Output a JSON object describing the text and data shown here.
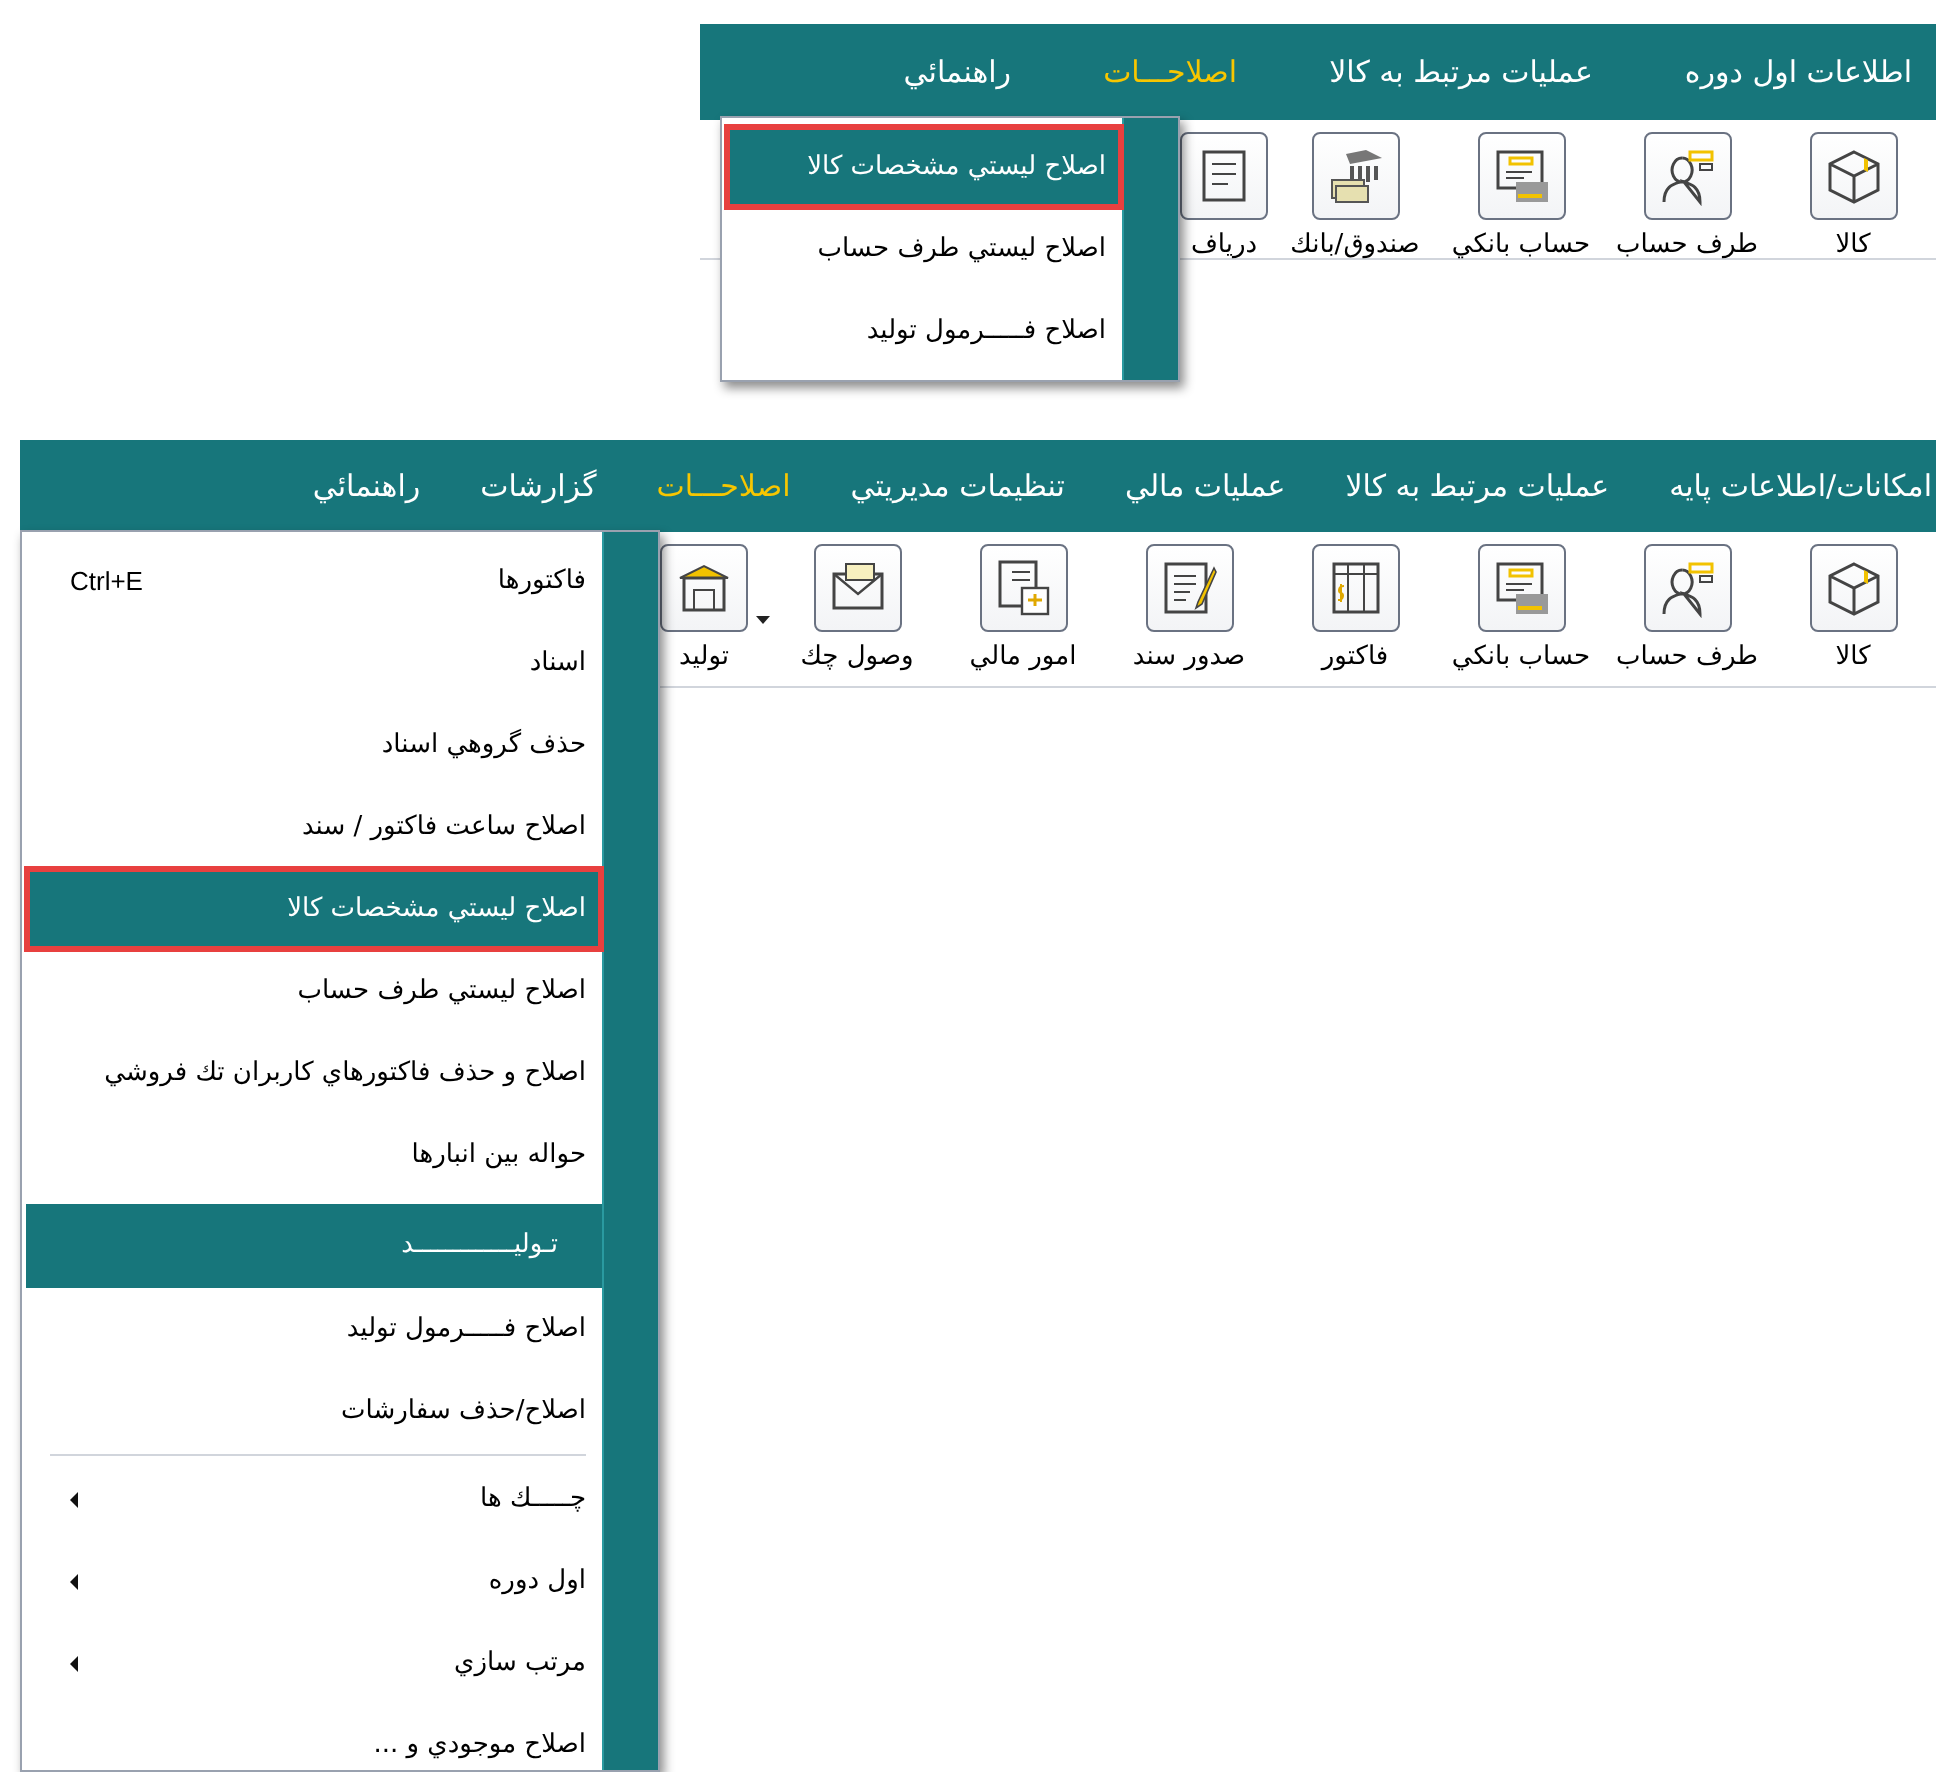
{
  "panels": [
    {
      "menubar": [
        {
          "label": "اطلاعات اول دوره",
          "selected": false
        },
        {
          "label": "عمليات مرتبط به كالا",
          "selected": false
        },
        {
          "label": "اصلاحـــات",
          "selected": true
        },
        {
          "label": "راهنمائي",
          "selected": false
        }
      ],
      "toolbar": [
        {
          "kind": "tool",
          "label": "كالا"
        },
        {
          "kind": "tool",
          "label": "طرف حساب"
        },
        {
          "kind": "tool",
          "label": "حساب بانكي"
        },
        {
          "kind": "tool",
          "label": "صندوق/بانك"
        },
        {
          "kind": "tool",
          "label": "درياف"
        }
      ],
      "menu": [
        {
          "kind": "item",
          "label": "اصلاح ليستي مشخصات كالا",
          "selected": true,
          "submenu": false
        },
        {
          "kind": "item",
          "label": "اصلاح ليستي طرف حساب",
          "selected": false,
          "submenu": false
        },
        {
          "kind": "item",
          "label": "اصلاح فـــــرمول توليد",
          "selected": false,
          "submenu": false
        }
      ]
    },
    {
      "menubar": [
        {
          "label": "امكانات/اطلاعات پايه",
          "selected": false
        },
        {
          "label": "عمليات مرتبط به كالا",
          "selected": false
        },
        {
          "label": "عمليات مالي",
          "selected": false
        },
        {
          "label": "تنظيمات مديريتي",
          "selected": false
        },
        {
          "label": "اصلاحـــات",
          "selected": true
        },
        {
          "label": "گزارشات",
          "selected": false
        },
        {
          "label": "راهنمائي",
          "selected": false
        }
      ],
      "toolbar": [
        {
          "kind": "tool",
          "label": "كالا"
        },
        {
          "kind": "tool",
          "label": "طرف حساب"
        },
        {
          "kind": "tool",
          "label": "حساب بانكي"
        },
        {
          "kind": "tool",
          "label": "فاكتور"
        },
        {
          "kind": "tool",
          "label": "صدور سند"
        },
        {
          "kind": "tool",
          "label": "امور مالي"
        },
        {
          "kind": "tool",
          "label": "وصول چك"
        },
        {
          "kind": "caret"
        },
        {
          "kind": "tool",
          "label": "توليد"
        }
      ],
      "menu": [
        {
          "kind": "item",
          "label": "فاكتورها",
          "shortcut": "Ctrl+E",
          "selected": false,
          "submenu": false
        },
        {
          "kind": "item",
          "label": "اسناد",
          "selected": false,
          "submenu": false
        },
        {
          "kind": "item",
          "label": "حذف گروهي اسناد",
          "selected": false,
          "submenu": false
        },
        {
          "kind": "item",
          "label": "اصلاح ساعت فاكتور / سند",
          "selected": false,
          "submenu": false
        },
        {
          "kind": "item",
          "label": "اصلاح ليستي مشخصات كالا",
          "selected": true,
          "submenu": false
        },
        {
          "kind": "item",
          "label": "اصلاح ليستي طرف حساب",
          "selected": false,
          "submenu": false
        },
        {
          "kind": "item",
          "label": "اصلاح و حذف فاكتورهاي كاربران تك فروشي",
          "selected": false,
          "submenu": false
        },
        {
          "kind": "item",
          "label": "حواله بين انبارها",
          "selected": false,
          "submenu": false
        },
        {
          "kind": "header",
          "label": "تـوليـــــــــــــد"
        },
        {
          "kind": "item",
          "label": "اصلاح فـــــرمول توليد",
          "selected": false,
          "submenu": false
        },
        {
          "kind": "item",
          "label": "اصلاح/حذف سفارشات",
          "selected": false,
          "submenu": false
        },
        {
          "kind": "separator"
        },
        {
          "kind": "item",
          "label": "چـــــك ها",
          "selected": false,
          "submenu": true
        },
        {
          "kind": "item",
          "label": "اول دوره",
          "selected": false,
          "submenu": true
        },
        {
          "kind": "item",
          "label": "مرتب سازي",
          "selected": false,
          "submenu": true
        },
        {
          "kind": "item",
          "label": "اصلاح موجودي و ...",
          "selected": false,
          "submenu": false
        }
      ]
    }
  ]
}
